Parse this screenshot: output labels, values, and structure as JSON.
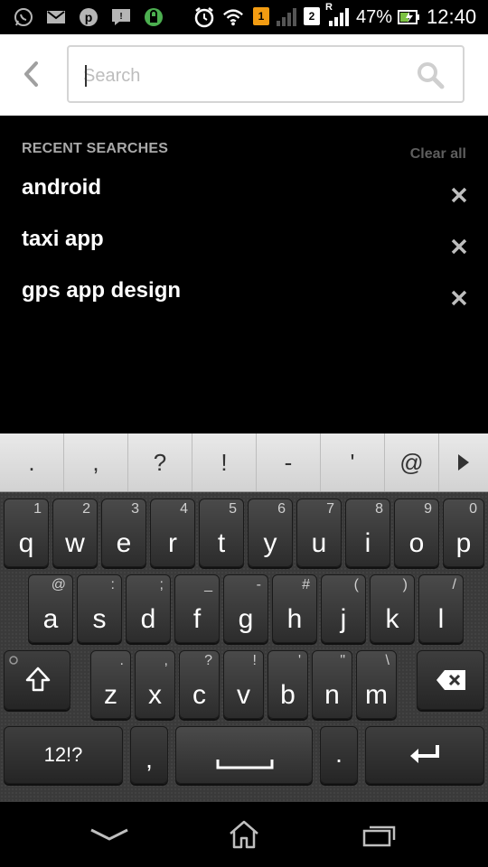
{
  "status_bar": {
    "battery_percent": "47%",
    "time": "12:40",
    "sim1_label": "1",
    "sim2_label": "2",
    "roaming_label": "R",
    "icons": [
      "whatsapp-icon",
      "gmail-icon",
      "pinterest-icon",
      "talk-icon",
      "lock-icon",
      "alarm-icon",
      "wifi-icon",
      "sim1-icon",
      "signal-icon",
      "sim2-icon",
      "signal-icon",
      "battery-charging-icon"
    ]
  },
  "search": {
    "placeholder": "Search",
    "value": ""
  },
  "recent": {
    "title": "RECENT SEARCHES",
    "clear_label": "Clear all",
    "items": [
      {
        "text": "android"
      },
      {
        "text": "taxi app"
      },
      {
        "text": "gps app design"
      }
    ]
  },
  "keyboard": {
    "symbols": [
      ".",
      ",",
      "?",
      "!",
      "-",
      "'",
      "@"
    ],
    "row1": [
      {
        "main": "q",
        "sub": "1"
      },
      {
        "main": "w",
        "sub": "2"
      },
      {
        "main": "e",
        "sub": "3"
      },
      {
        "main": "r",
        "sub": "4"
      },
      {
        "main": "t",
        "sub": "5"
      },
      {
        "main": "y",
        "sub": "6"
      },
      {
        "main": "u",
        "sub": "7"
      },
      {
        "main": "i",
        "sub": "8"
      },
      {
        "main": "o",
        "sub": "9"
      },
      {
        "main": "p",
        "sub": "0"
      }
    ],
    "row2": [
      {
        "main": "a",
        "sub": "@"
      },
      {
        "main": "s",
        "sub": ":"
      },
      {
        "main": "d",
        "sub": ";"
      },
      {
        "main": "f",
        "sub": "_"
      },
      {
        "main": "g",
        "sub": "-"
      },
      {
        "main": "h",
        "sub": "#"
      },
      {
        "main": "j",
        "sub": "("
      },
      {
        "main": "k",
        "sub": ")"
      },
      {
        "main": "l",
        "sub": "/"
      }
    ],
    "row3": [
      {
        "main": "z",
        "sub": "."
      },
      {
        "main": "x",
        "sub": ","
      },
      {
        "main": "c",
        "sub": "?"
      },
      {
        "main": "v",
        "sub": "!"
      },
      {
        "main": "b",
        "sub": "'"
      },
      {
        "main": "n",
        "sub": "\""
      },
      {
        "main": "m",
        "sub": "\\"
      }
    ],
    "mode_label": "12!?",
    "comma_label": ",",
    "period_label": "."
  },
  "colors": {
    "header_bg": "#ffffff",
    "background": "#000000",
    "recent_title": "#a9a9a9",
    "clear_all": "#5e5e5e",
    "keyboard_bg": "#3a3a3a",
    "symbol_row_bg": "#e0e0e0"
  }
}
